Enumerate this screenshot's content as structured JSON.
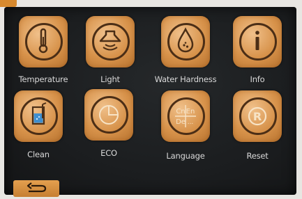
{
  "tiles": [
    {
      "label": "Temperature",
      "icon": "thermometer-icon"
    },
    {
      "label": "Light",
      "icon": "hood-light-icon"
    },
    {
      "label": "Water Hardness",
      "icon": "water-drop-icon"
    },
    {
      "label": "Info",
      "icon": "info-icon"
    },
    {
      "label": "Clean",
      "icon": "clean-glass-icon"
    },
    {
      "label": "ECO",
      "icon": "eco-clock-icon"
    },
    {
      "label": "Language",
      "icon": "language-grid-icon"
    },
    {
      "label": "Reset",
      "icon": "reset-r-icon"
    }
  ],
  "language_icon": {
    "cells": [
      "Cn",
      "En",
      "De",
      "..."
    ]
  },
  "reset_icon": {
    "letter": "R"
  },
  "info_icon": {
    "letter": "i"
  },
  "back": {
    "icon": "back-arrow-icon"
  },
  "colors": {
    "tile": "#d7924a",
    "icon_stroke": "#4b2e16",
    "panel": "#1b1d1f",
    "label": "#d9d9d9"
  }
}
